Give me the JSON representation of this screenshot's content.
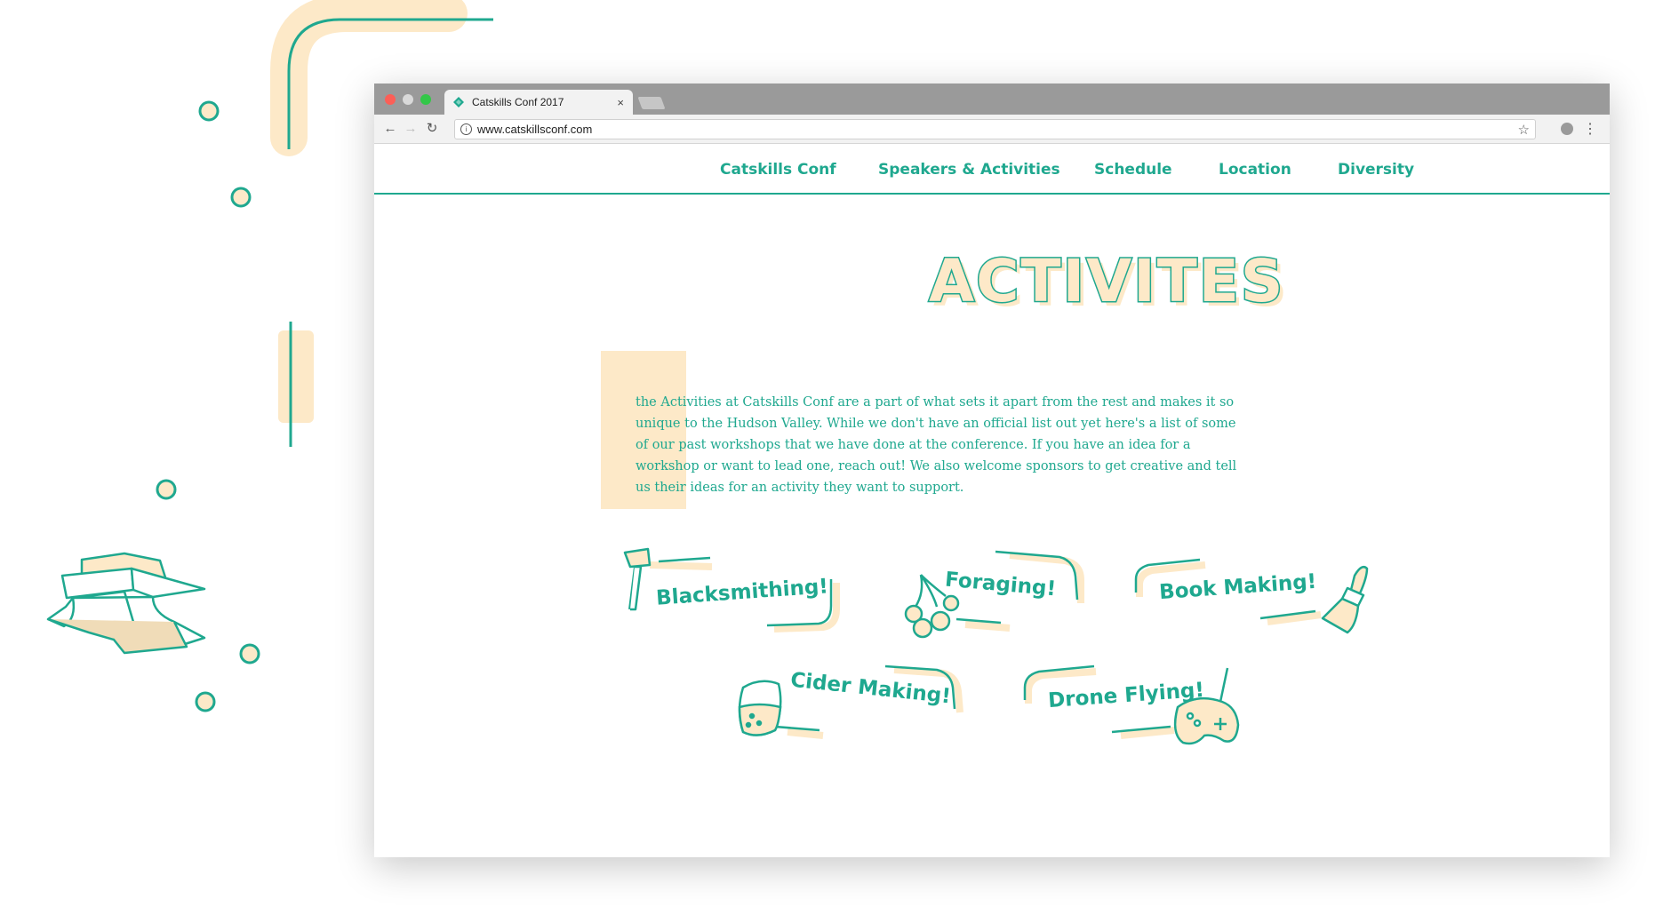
{
  "browser": {
    "tab_title": "Catskills Conf 2017",
    "tab_close": "×",
    "url": "www.catskillsconf.com",
    "star_glyph": "☆",
    "back_glyph": "←",
    "forward_glyph": "→",
    "reload_glyph": "↻",
    "menu_glyph": "⋮",
    "info_glyph": "i"
  },
  "nav": {
    "items": [
      {
        "label": "Catskills Conf"
      },
      {
        "label": "Speakers & Activities"
      },
      {
        "label": "Schedule"
      },
      {
        "label": "Location"
      },
      {
        "label": "Diversity"
      }
    ]
  },
  "page": {
    "heading": "ACTIVITES",
    "intro": "the Activities at Catskills Conf are a part of what sets it apart from the rest and makes it so unique to the Hudson Valley. While we don't have an official list out yet here's a list of some of our past workshops that we have done at the conference. If you have an idea for a workshop or want to lead one, reach out! We also welcome sponsors to get creative and tell us their ideas for an activity they want to support."
  },
  "activities": [
    {
      "label": "Blacksmithing!",
      "icon": "hammer-icon"
    },
    {
      "label": "Foraging!",
      "icon": "cherries-icon"
    },
    {
      "label": "Book Making!",
      "icon": "paintbrush-icon"
    },
    {
      "label": "Cider Making!",
      "icon": "cider-glass-icon"
    },
    {
      "label": "Drone Flying!",
      "icon": "game-controller-icon"
    }
  ],
  "colors": {
    "teal": "#1fa88f",
    "cream": "#fde9c8",
    "tabbar": "#9a9a9a"
  }
}
